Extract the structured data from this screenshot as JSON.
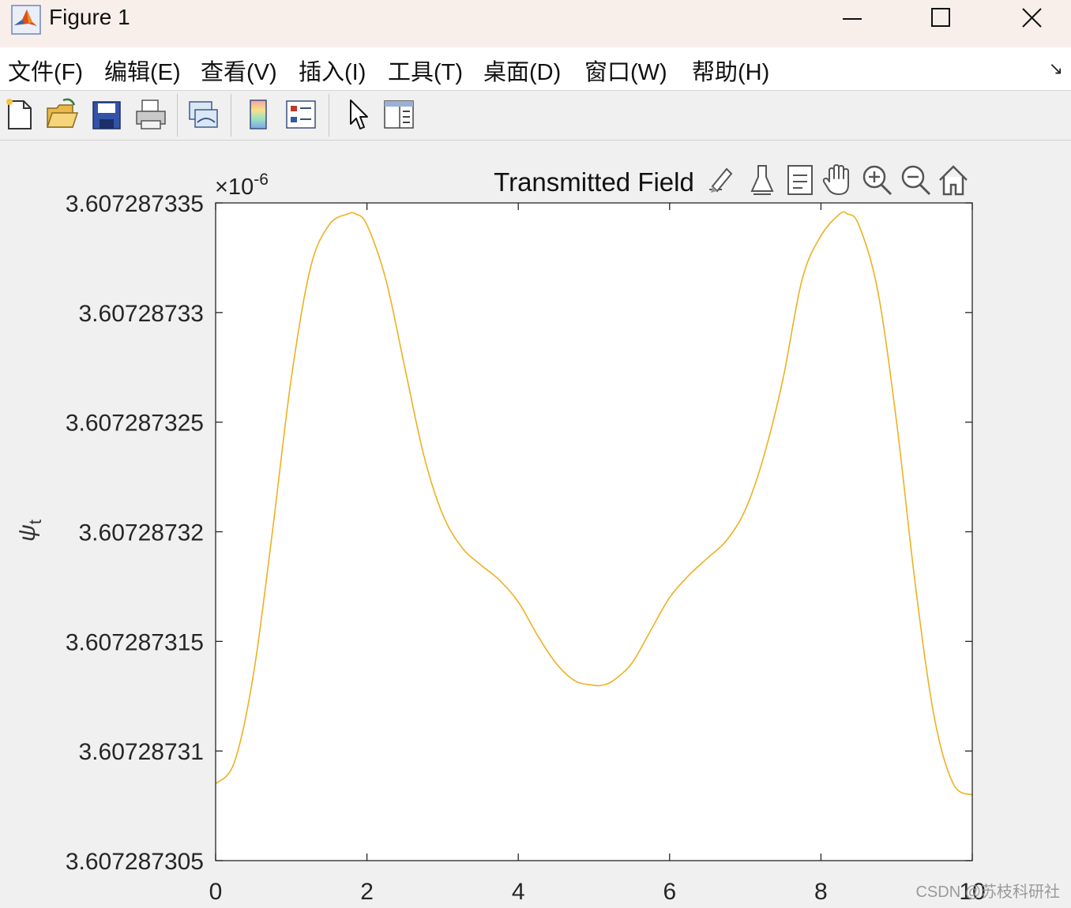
{
  "window": {
    "title": "Figure 1",
    "icons": {
      "app": "matlab-logo-icon",
      "minimize": "minimize-icon",
      "maximize": "maximize-icon",
      "close": "close-icon"
    }
  },
  "menubar": {
    "items": [
      "文件(F)",
      "编辑(E)",
      "查看(V)",
      "插入(I)",
      "工具(T)",
      "桌面(D)",
      "窗口(W)",
      "帮助(H)"
    ],
    "dock_icon": "dock-arrow-icon"
  },
  "toolbar": {
    "buttons": [
      "new-figure-icon",
      "open-file-icon",
      "save-icon",
      "print-icon",
      "link-plot-icon",
      "colorbar-icon",
      "legend-icon",
      "edit-plot-icon",
      "property-inspector-icon"
    ]
  },
  "axes_toolbar": {
    "buttons": [
      "brush-icon",
      "data-tips-icon",
      "restore-view-icon",
      "pan-icon",
      "zoom-in-icon",
      "zoom-out-icon",
      "home-icon"
    ]
  },
  "chart_data": {
    "type": "line",
    "title": "Transmitted Field",
    "xlabel": "",
    "ylabel": "ψ_t",
    "ylabel_symbol": "ψ",
    "ylabel_sub": "t",
    "y_exponent_label": "×10",
    "y_exponent_power": "-6",
    "xlim": [
      0,
      10
    ],
    "ylim": [
      3.607287305,
      3.607287335
    ],
    "x_ticks": [
      "0",
      "2",
      "4",
      "6",
      "8",
      "10"
    ],
    "x_tick_values": [
      0,
      2,
      4,
      6,
      8,
      10
    ],
    "y_ticks": [
      "3.607287305",
      "3.60728731",
      "3.607287315",
      "3.60728732",
      "3.607287325",
      "3.60728733",
      "3.607287335"
    ],
    "y_tick_values": [
      3.607287305,
      3.60728731,
      3.607287315,
      3.60728732,
      3.607287325,
      3.60728733,
      3.607287335
    ],
    "grid": false,
    "line_color": "#EDB120",
    "series": [
      {
        "x": [
          0,
          0.25,
          0.5,
          0.75,
          1.0,
          1.25,
          1.5,
          1.75,
          1.85,
          2.0,
          2.25,
          2.5,
          2.75,
          3.0,
          3.25,
          3.5,
          3.75,
          4.0,
          4.25,
          4.5,
          4.75,
          5.0,
          5.1,
          5.25,
          5.5,
          5.75,
          6.0,
          6.25,
          6.5,
          6.75,
          7.0,
          7.25,
          7.5,
          7.75,
          8.0,
          8.25,
          8.35,
          8.5,
          8.75,
          9.0,
          9.25,
          9.5,
          9.75,
          10.0
        ],
        "y": [
          3.6072873085,
          3.6072873095,
          3.6072873135,
          3.60728732,
          3.607287327,
          3.607287332,
          3.607287334,
          3.6072873345,
          3.6072873345,
          3.607287334,
          3.6072873315,
          3.6072873275,
          3.6072873235,
          3.6072873208,
          3.6072873193,
          3.6072873185,
          3.6072873178,
          3.6072873168,
          3.6072873153,
          3.607287314,
          3.6072873132,
          3.607287313,
          3.607287313,
          3.6072873132,
          3.607287314,
          3.6072873155,
          3.607287317,
          3.607287318,
          3.6072873188,
          3.6072873196,
          3.607287321,
          3.6072873235,
          3.607287327,
          3.6072873315,
          3.6072873335,
          3.6072873345,
          3.6072873345,
          3.607287334,
          3.607287331,
          3.607287325,
          3.6072873175,
          3.6072873115,
          3.6072873085,
          3.607287308
        ]
      }
    ]
  },
  "watermark": "CSDN @苏枝科研社"
}
